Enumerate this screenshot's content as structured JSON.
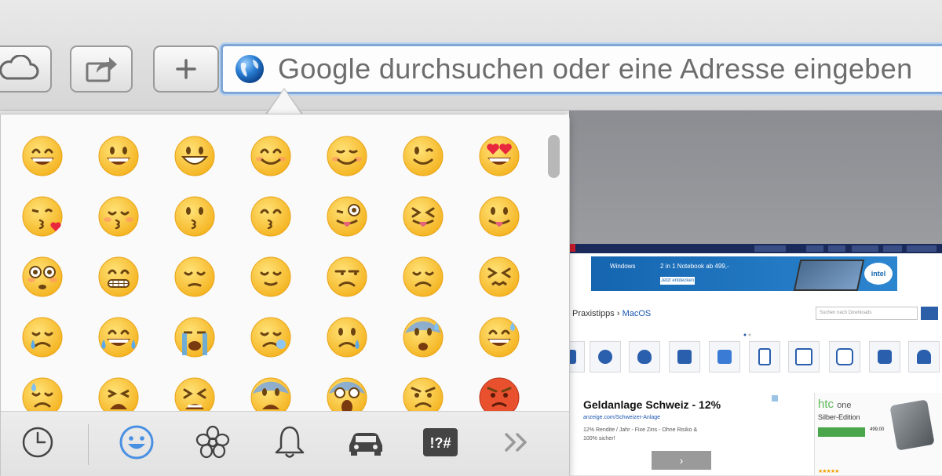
{
  "toolbar": {
    "url_placeholder": "Google durchsuchen oder eine Adresse eingeben",
    "buttons": [
      {
        "name": "icloud-tabs-button",
        "icon": "cloud-icon"
      },
      {
        "name": "share-button",
        "icon": "share-icon"
      },
      {
        "name": "new-tab-button",
        "icon": "plus-icon"
      }
    ]
  },
  "emoji_picker": {
    "emojis": [
      "😄",
      "😃",
      "😀",
      "😊",
      "☺️",
      "😉",
      "😍",
      "😘",
      "😚",
      "😗",
      "😙",
      "😜",
      "😝",
      "😛",
      "😳",
      "😁",
      "😔",
      "😌",
      "😒",
      "😞",
      "😣",
      "😢",
      "😂",
      "😭",
      "😪",
      "😥",
      "😰",
      "😅",
      "😓",
      "😩",
      "😫",
      "😨",
      "😱",
      "😠",
      "😡"
    ],
    "categories": [
      {
        "name": "recent",
        "icon": "clock-icon",
        "selected": false
      },
      {
        "name": "people",
        "icon": "smiley-icon",
        "selected": true
      },
      {
        "name": "nature",
        "icon": "flower-icon",
        "selected": false
      },
      {
        "name": "objects",
        "icon": "bell-icon",
        "selected": false
      },
      {
        "name": "places",
        "icon": "car-icon",
        "selected": false
      },
      {
        "name": "symbols",
        "icon": "symbols-icon",
        "label": "!?#",
        "selected": false
      },
      {
        "name": "more",
        "icon": "double-chevron-right-icon",
        "label": "»",
        "selected": false
      }
    ],
    "accent_color": "#4a90e2"
  },
  "webpage": {
    "ad_brand": "Windows",
    "ad_text": "2 in 1 Notebook ab 499,-",
    "ad_button": "Jetzt entdecken",
    "ad_logo": "intel",
    "breadcrumb_prefix": "Praxistipps › ",
    "breadcrumb_link": "MacOS",
    "search_placeholder": "Suchen nach Downloads",
    "headline": "Geldanlage Schweiz - 12%",
    "link": "anzeige.com/Schweizer-Anlage",
    "description_lines": [
      "12% Rendite / Jahr - Fixe Zins - Ohne Risiko &",
      "100% sicher!"
    ],
    "next_button": "›",
    "htc_brand": "htc",
    "htc_model": "one",
    "htc_subtitle": "Silber-Edition",
    "htc_price": "499,00",
    "htc_stars": "★★★★★"
  }
}
